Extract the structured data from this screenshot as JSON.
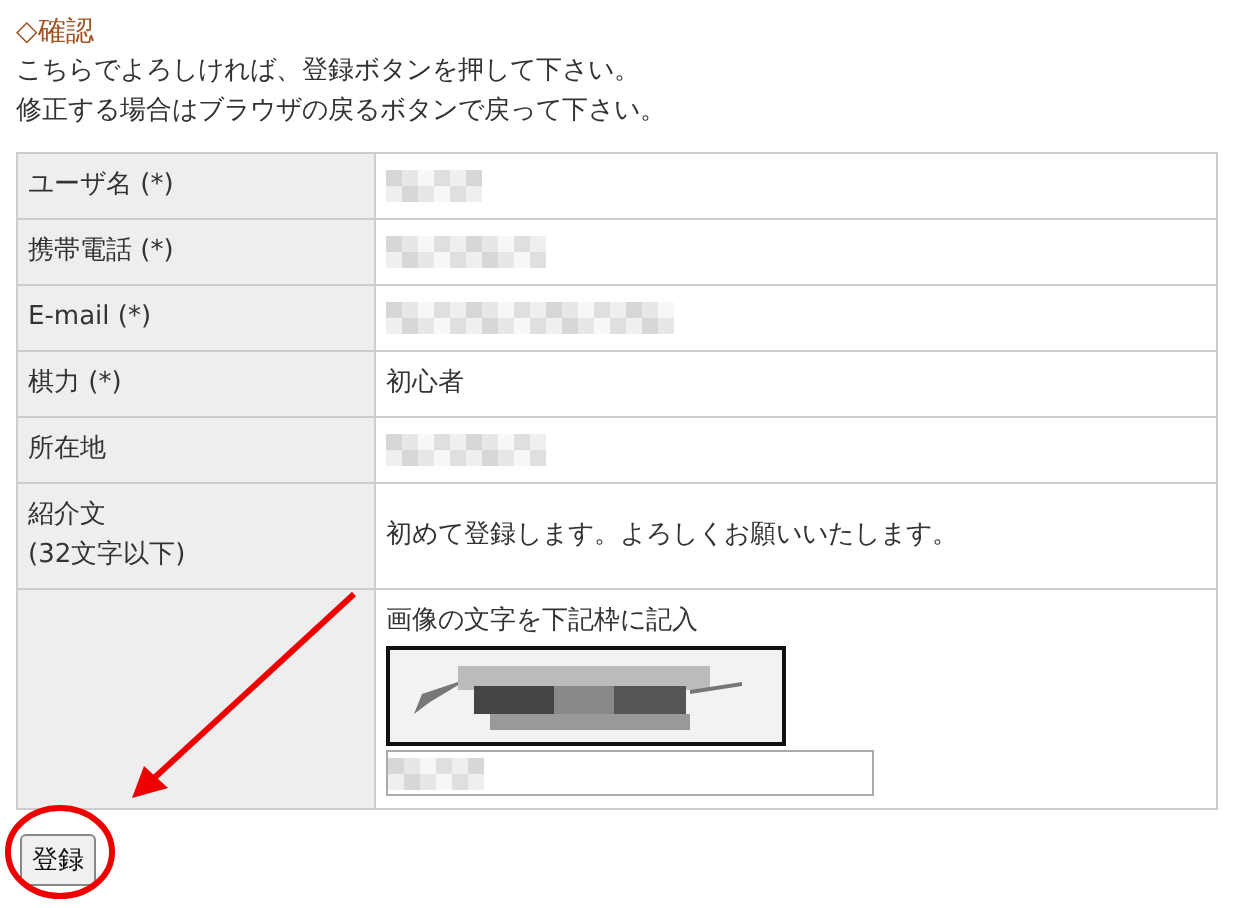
{
  "heading": "◇確認",
  "instructions": [
    "こちらでよろしければ、登録ボタンを押して下さい。",
    "修正する場合はブラウザの戻るボタンで戻って下さい。"
  ],
  "rows": [
    {
      "label": "ユーザ名 (*)",
      "kind": "redacted"
    },
    {
      "label": "携帯電話 (*)",
      "kind": "redacted"
    },
    {
      "label": "E-mail (*)",
      "kind": "redacted"
    },
    {
      "label": "棋力 (*)",
      "kind": "text",
      "value": "初心者"
    },
    {
      "label": "所在地",
      "kind": "redacted"
    },
    {
      "label": "紹介文",
      "note": "(32文字以下)",
      "kind": "text",
      "value": "初めて登録します。よろしくお願いいたします。"
    },
    {
      "kind": "captcha",
      "prompt": "画像の文字を下記枠に記入",
      "input_redacted": true
    }
  ],
  "submit_button": "登録",
  "annotation": {
    "arrow": true,
    "circle": true
  }
}
